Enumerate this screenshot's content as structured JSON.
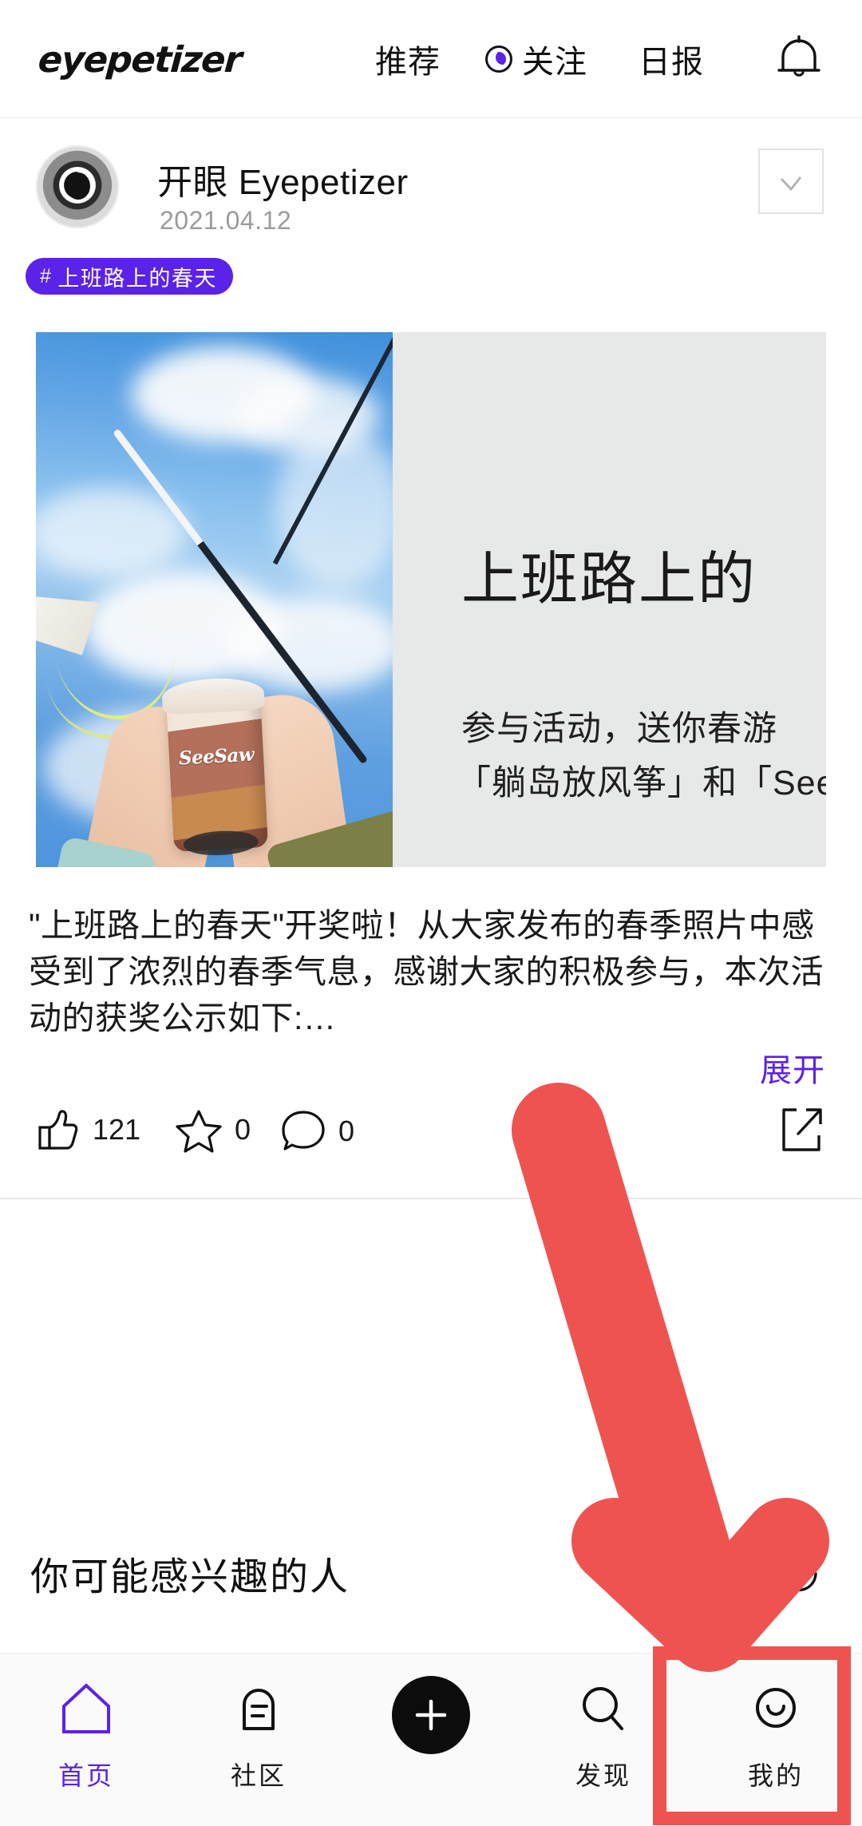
{
  "header": {
    "brand": "eyepetizer",
    "tabs": [
      {
        "label": "推荐",
        "active": false
      },
      {
        "label": "关注",
        "active": false,
        "icon": "eye-badge-icon"
      },
      {
        "label": "日报",
        "active": false
      }
    ],
    "notification_icon": "bell-icon"
  },
  "post": {
    "author": {
      "name": "开眼 Eyepetizer",
      "date": "2021.04.12",
      "avatar_icon": "eye-avatar",
      "follow_state_icon": "check-icon"
    },
    "tag": {
      "hash": "#",
      "label": "上班路上的春天"
    },
    "media": {
      "poster_title": "上班路上的",
      "poster_line1": "参与活动，送你春游",
      "poster_line2": "「躺岛放风筝」和「See",
      "photo_alt": "双手举着 SeeSaw 咖啡杯，背景蓝天白云与风筝",
      "cup_logo": "SeeSaw"
    },
    "description": "\"上班路上的春天\"开奖啦！从大家发布的春季照片中感受到了浓烈的春季气息，感谢大家的积极参与，本次活动的获奖公示如下:…",
    "expand_label": "展开",
    "actions": {
      "like": {
        "icon": "thumbs-up-icon",
        "count": "121"
      },
      "favorite": {
        "icon": "star-icon",
        "count": "0"
      },
      "comment": {
        "icon": "comment-icon",
        "count": "0"
      },
      "share": {
        "icon": "share-icon"
      }
    }
  },
  "suggested": {
    "title": "你可能感兴趣的人",
    "refresh_icon": "refresh-icon"
  },
  "tabbar": {
    "items": [
      {
        "label": "首页",
        "icon": "home-icon",
        "active": true
      },
      {
        "label": "社区",
        "icon": "community-icon",
        "active": false
      },
      {
        "label": "",
        "icon": "plus-icon",
        "active": false
      },
      {
        "label": "发现",
        "icon": "search-icon",
        "active": false
      },
      {
        "label": "我的",
        "icon": "profile-smiley-icon",
        "active": false
      }
    ]
  },
  "annotations": {
    "arrow_color": "#ef5350",
    "highlight_color": "#ef5350",
    "highlight_target": "我的"
  },
  "colors": {
    "accent_purple": "#5b22e8",
    "annotation_red": "#ef5350",
    "text_primary": "#1a1a1a",
    "text_muted": "#9b9b9b"
  }
}
